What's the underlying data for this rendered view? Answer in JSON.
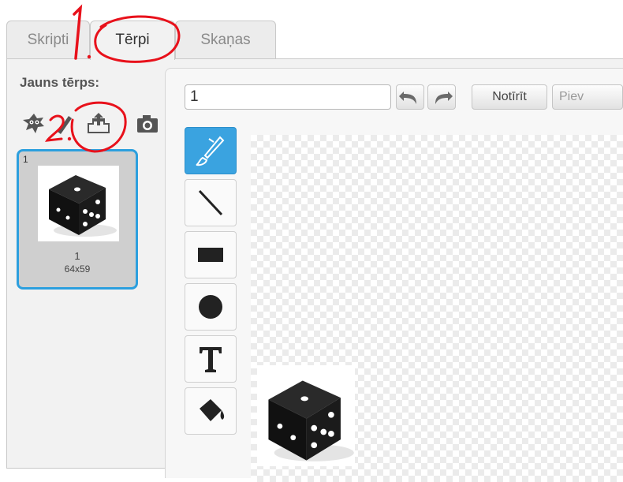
{
  "tabs": [
    {
      "label": "Skripti"
    },
    {
      "label": "Tērpi"
    },
    {
      "label": "Skaņas"
    }
  ],
  "new_costume_label": "Jauns tērps:",
  "costume_tile": {
    "index": "1",
    "name": "1",
    "size": "64x59"
  },
  "toolbar": {
    "name_value": "1",
    "clear_label": "Notīrīt",
    "import_label": "Piev"
  },
  "annotations": {
    "one": "1.",
    "two": "2."
  },
  "colors": {
    "accent": "#2c9fde",
    "selected_tool": "#3aa3e0",
    "annotation": "#e8111b"
  },
  "tools": [
    "brush-icon",
    "line-icon",
    "rectangle-icon",
    "ellipse-icon",
    "text-icon",
    "fill-icon"
  ]
}
